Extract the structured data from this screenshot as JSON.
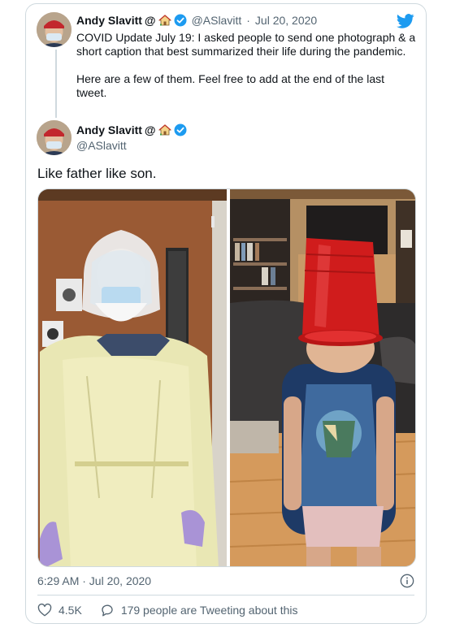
{
  "tweet": {
    "author_name": "Andy Slavitt",
    "name_suffix": "@",
    "handle": "@ASlavitt",
    "separator": "·",
    "date_short": "Jul 20, 2020",
    "text_paragraph_1": "COVID Update July 19: I asked people to send one photograph & a short caption that best summarized their life during the pandemic.",
    "text_paragraph_2": "Here are a few of them. Feel free to add at the end of the last tweet."
  },
  "quoted": {
    "author_name": "Andy Slavitt",
    "name_suffix": "@",
    "handle": "@ASlavitt",
    "caption": "Like father like son."
  },
  "footer": {
    "timestamp": "6:29 AM · Jul 20, 2020",
    "likes": "4.5K",
    "tweeting": "179 people are Tweeting about this"
  },
  "icons": {
    "bird": "twitter-bird-icon",
    "verified": "verified-badge-icon",
    "house": "house-emoji-icon",
    "heart": "heart-icon",
    "comment": "comment-icon",
    "info": "info-icon"
  },
  "colors": {
    "brand_blue": "#1d9bf0",
    "text_primary": "#0f1419",
    "text_secondary": "#536471",
    "border": "#cfd9de",
    "cup_red": "#d01c1c"
  }
}
